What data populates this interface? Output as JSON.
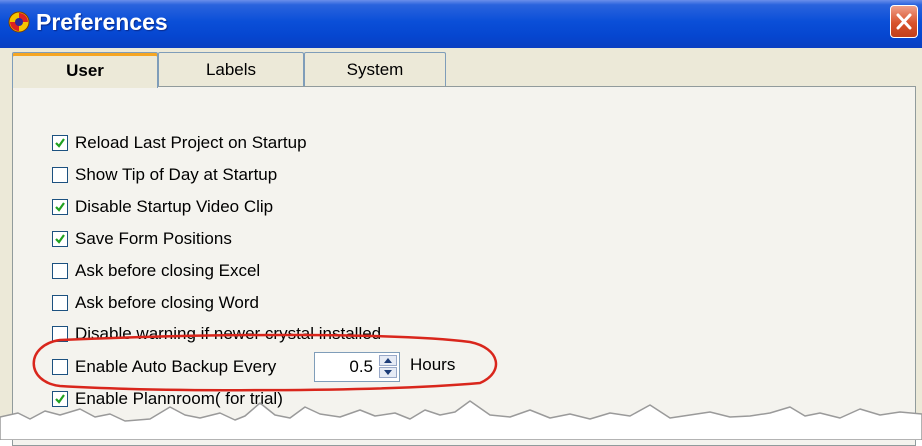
{
  "window": {
    "title": "Preferences"
  },
  "tabs": [
    {
      "label": "User",
      "active": true
    },
    {
      "label": "Labels",
      "active": false
    },
    {
      "label": "System",
      "active": false
    }
  ],
  "options": [
    {
      "label": "Reload Last Project on Startup",
      "checked": true
    },
    {
      "label": "Show Tip of Day at Startup",
      "checked": false
    },
    {
      "label": "Disable Startup Video Clip",
      "checked": true
    },
    {
      "label": "Save Form Positions",
      "checked": true
    },
    {
      "label": "Ask before closing Excel",
      "checked": false
    },
    {
      "label": "Ask before closing Word",
      "checked": false
    },
    {
      "label": "Disable warning if newer crystal installed",
      "checked": false
    },
    {
      "label": "Enable Auto Backup Every",
      "checked": false
    },
    {
      "label": "Enable Plannroom( for trial)",
      "checked": true
    }
  ],
  "backup": {
    "interval": "0.5",
    "unit": "Hours"
  },
  "colors": {
    "titlebar": "#0a4fd8",
    "annotation": "#d9261c",
    "check": "#21a121",
    "tab_highlight": "#f5a623"
  }
}
